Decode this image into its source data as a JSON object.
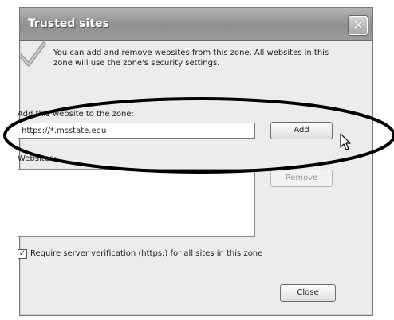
{
  "dialog": {
    "title": "Trusted sites",
    "close_symbol": "✕",
    "info_text": "You can add and remove websites from this zone. All websites in this zone will use the zone's security settings."
  },
  "add_section": {
    "label": "Add this website to the zone:",
    "input_value": "https://*.msstate.edu",
    "add_button": "Add"
  },
  "websites_section": {
    "label": "Websites:",
    "items": [],
    "remove_button": "Remove"
  },
  "options": {
    "require_https_checked": true,
    "check_mark": "✓",
    "require_https_label": "Require server verification (https:) for all sites in this zone"
  },
  "footer": {
    "close_button": "Close"
  },
  "icons": {
    "header": "checkmark-icon",
    "cursor": "mouse-pointer-icon"
  }
}
